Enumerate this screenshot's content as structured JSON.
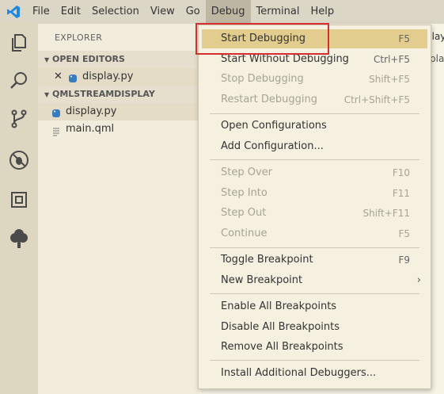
{
  "menubar": {
    "items": [
      "File",
      "Edit",
      "Selection",
      "View",
      "Go",
      "Debug",
      "Terminal",
      "Help"
    ]
  },
  "sidebar": {
    "title": "EXPLORER",
    "open_editors": {
      "header": "OPEN EDITORS",
      "files": [
        "display.py"
      ]
    },
    "project": {
      "header": "QMLSTREAMDISPLAY",
      "files": [
        "display.py",
        "main.qml"
      ]
    }
  },
  "editor": {
    "visible_fragments": [
      "play",
      "pla"
    ]
  },
  "debug_menu": {
    "items": [
      {
        "label": "Start Debugging",
        "key": "F5",
        "state": "highlighted"
      },
      {
        "label": "Start Without Debugging",
        "key": "Ctrl+F5",
        "state": "enabled"
      },
      {
        "label": "Stop Debugging",
        "key": "Shift+F5",
        "state": "disabled"
      },
      {
        "label": "Restart Debugging",
        "key": "Ctrl+Shift+F5",
        "state": "disabled"
      },
      {
        "label": "Open Configurations",
        "key": "",
        "state": "enabled"
      },
      {
        "label": "Add Configuration...",
        "key": "",
        "state": "enabled"
      },
      {
        "label": "Step Over",
        "key": "F10",
        "state": "disabled"
      },
      {
        "label": "Step Into",
        "key": "F11",
        "state": "disabled"
      },
      {
        "label": "Step Out",
        "key": "Shift+F11",
        "state": "disabled"
      },
      {
        "label": "Continue",
        "key": "F5",
        "state": "disabled"
      },
      {
        "label": "Toggle Breakpoint",
        "key": "F9",
        "state": "enabled"
      },
      {
        "label": "New Breakpoint",
        "key": "",
        "state": "enabled"
      },
      {
        "label": "Enable All Breakpoints",
        "key": "",
        "state": "enabled"
      },
      {
        "label": "Disable All Breakpoints",
        "key": "",
        "state": "enabled"
      },
      {
        "label": "Remove All Breakpoints",
        "key": "",
        "state": "enabled"
      },
      {
        "label": "Install Additional Debuggers...",
        "key": "",
        "state": "enabled"
      }
    ]
  },
  "activitybar": {
    "icons": [
      "files-icon",
      "search-icon",
      "source-control-icon",
      "debug-icon",
      "extensions-icon",
      "tree-icon"
    ]
  },
  "colors": {
    "menubar": "#dcd6c7",
    "activitybar": "#ddd6c1",
    "sidebar": "#f2ecdc",
    "menu_highlight": "#e2cd8e",
    "annotation_box": "#d32f2f",
    "accent_blue": "#1e88e5"
  }
}
